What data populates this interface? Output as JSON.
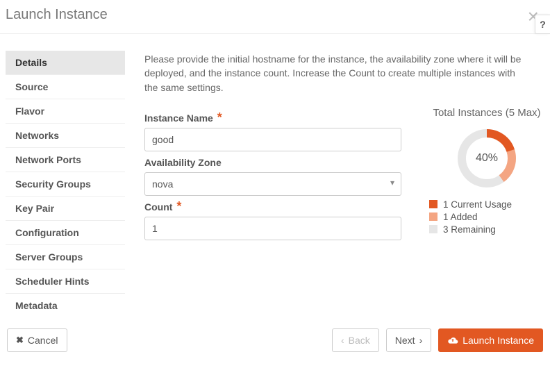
{
  "header": {
    "title": "Launch Instance"
  },
  "sidebar": {
    "items": [
      {
        "label": "Details",
        "active": true
      },
      {
        "label": "Source"
      },
      {
        "label": "Flavor"
      },
      {
        "label": "Networks"
      },
      {
        "label": "Network Ports"
      },
      {
        "label": "Security Groups"
      },
      {
        "label": "Key Pair"
      },
      {
        "label": "Configuration"
      },
      {
        "label": "Server Groups"
      },
      {
        "label": "Scheduler Hints"
      },
      {
        "label": "Metadata"
      }
    ]
  },
  "main": {
    "description": "Please provide the initial hostname for the instance, the availability zone where it will be deployed, and the instance count. Increase the Count to create multiple instances with the same settings.",
    "fields": {
      "instance_name": {
        "label": "Instance Name",
        "value": "good",
        "required": true
      },
      "availability_zone": {
        "label": "Availability Zone",
        "value": "nova",
        "required": false
      },
      "count": {
        "label": "Count",
        "value": "1",
        "required": true
      }
    },
    "summary": {
      "title": "Total Instances (5 Max)",
      "percent_label": "40%",
      "legend": {
        "current": "1 Current Usage",
        "added": "1 Added",
        "remaining": "3 Remaining"
      }
    }
  },
  "chart_data": {
    "type": "pie",
    "title": "Total Instances (5 Max)",
    "series": [
      {
        "name": "Current Usage",
        "value": 1,
        "color": "#e25822"
      },
      {
        "name": "Added",
        "value": 1,
        "color": "#f4a582"
      },
      {
        "name": "Remaining",
        "value": 3,
        "color": "#e6e6e6"
      }
    ],
    "total": 5,
    "percent_filled": 40
  },
  "footer": {
    "cancel": "Cancel",
    "back": "Back",
    "next": "Next",
    "launch": "Launch Instance"
  }
}
